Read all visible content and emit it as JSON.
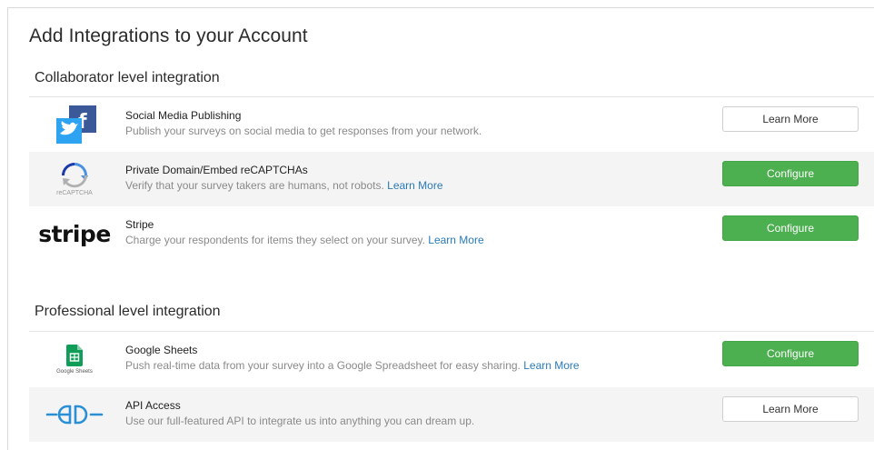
{
  "page": {
    "title": "Add Integrations to your Account"
  },
  "colors": {
    "accent_green": "#4caf50",
    "link_blue": "#2a7ab8",
    "muted_text": "#8a8a8a"
  },
  "sections": [
    {
      "title": "Collaborator level integration",
      "items": [
        {
          "icon": "twitter-facebook-logo",
          "title": "Social Media Publishing",
          "description": "Publish your surveys on social media to get responses from your network.",
          "link": "",
          "button": "Learn More",
          "button_style": "outline"
        },
        {
          "icon": "recaptcha-logo",
          "logo_text": "reCAPTCHA",
          "title": "Private Domain/Embed reCAPTCHAs",
          "description": "Verify that your survey takers are humans, not robots.",
          "link": "Learn More",
          "button": "Configure",
          "button_style": "green"
        },
        {
          "icon": "stripe-logo",
          "logo_text": "stripe",
          "title": "Stripe",
          "description": "Charge your respondents for items they select on your survey.",
          "link": "Learn More",
          "button": "Configure",
          "button_style": "green"
        }
      ]
    },
    {
      "title": "Professional level integration",
      "items": [
        {
          "icon": "google-sheets-logo",
          "logo_text": "Google Sheets",
          "title": "Google Sheets",
          "description": "Push real-time data from your survey into a Google Spreadsheet for easy sharing.",
          "link": "Learn More",
          "button": "Configure",
          "button_style": "green"
        },
        {
          "icon": "api-plug-icon",
          "title": "API Access",
          "description": "Use our full-featured API to integrate us into anything you can dream up.",
          "link": "",
          "button": "Learn More",
          "button_style": "outline"
        }
      ]
    }
  ]
}
